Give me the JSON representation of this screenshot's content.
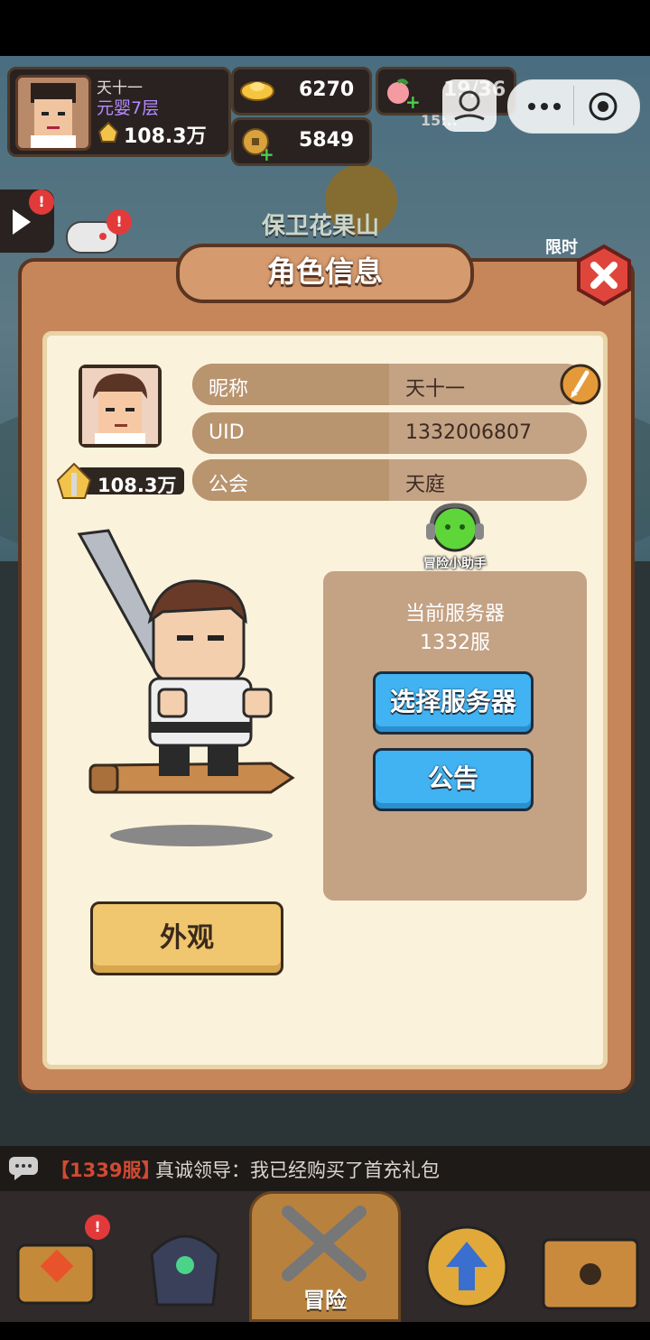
{
  "hud": {
    "player_name": "天十一",
    "player_realm": "元婴7层",
    "player_power": "108.3万",
    "gold": "6270",
    "coins": "5849",
    "stamina": "19/36",
    "stamina_timer": "15:..",
    "event_banner": "保卫花果山",
    "limited_label": "限时"
  },
  "dialog": {
    "title": "角色信息",
    "rows": [
      {
        "label": "昵称",
        "value": "天十一"
      },
      {
        "label": "UID",
        "value": "1332006807"
      },
      {
        "label": "公会",
        "value": "天庭"
      }
    ],
    "power": "108.3万",
    "helper_label": "冒险小助手",
    "server_title": "当前服务器",
    "server_name": "1332服",
    "select_server_button": "选择服务器",
    "notice_button": "公告",
    "appearance_button": "外观"
  },
  "chat": {
    "server_tag": "【1339服】",
    "message": "真诚领导：我已经购买了首充礼包"
  },
  "nav": {
    "adventure_label": "冒险"
  },
  "colors": {
    "dialog_bg": "#c6865a",
    "panel_bg": "#fbf2dc",
    "button_blue": "#41b3f2",
    "button_gold": "#f0c66e",
    "close_red": "#e0453c"
  }
}
